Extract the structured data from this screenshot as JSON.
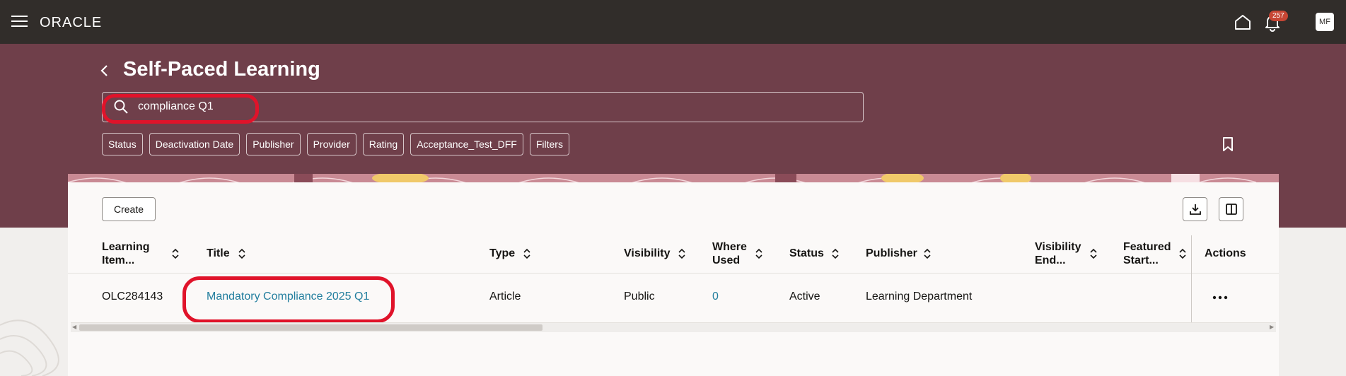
{
  "topbar": {
    "brand": "ORACLE",
    "notifications_count": "257",
    "avatar_initials": "MF"
  },
  "header": {
    "title": "Self-Paced Learning",
    "search_value": "compliance Q1",
    "filter_chips": [
      "Status",
      "Deactivation Date",
      "Publisher",
      "Provider",
      "Rating",
      "Acceptance_Test_DFF",
      "Filters"
    ]
  },
  "toolbar": {
    "create_label": "Create"
  },
  "table": {
    "columns": [
      {
        "line1": "Learning",
        "line2": "Item..."
      },
      {
        "line1": "Title"
      },
      {
        "line1": "Type"
      },
      {
        "line1": "Visibility"
      },
      {
        "line1": "Where",
        "line2": "Used"
      },
      {
        "line1": "Status"
      },
      {
        "line1": "Publisher"
      },
      {
        "line1": "Visibility",
        "line2": "End..."
      },
      {
        "line1": "Featured",
        "line2": "Start..."
      },
      {
        "line1": "Actions"
      }
    ],
    "rows": [
      {
        "item": "OLC284143",
        "title": "Mandatory Compliance 2025 Q1",
        "type": "Article",
        "visibility": "Public",
        "where_used": "0",
        "status": "Active",
        "publisher": "Learning Department"
      }
    ]
  },
  "colors": {
    "topbar": "#312d2a",
    "header": "#6f3f4a",
    "link": "#227e9e",
    "highlight": "#e0132a",
    "badge": "#c74634"
  }
}
